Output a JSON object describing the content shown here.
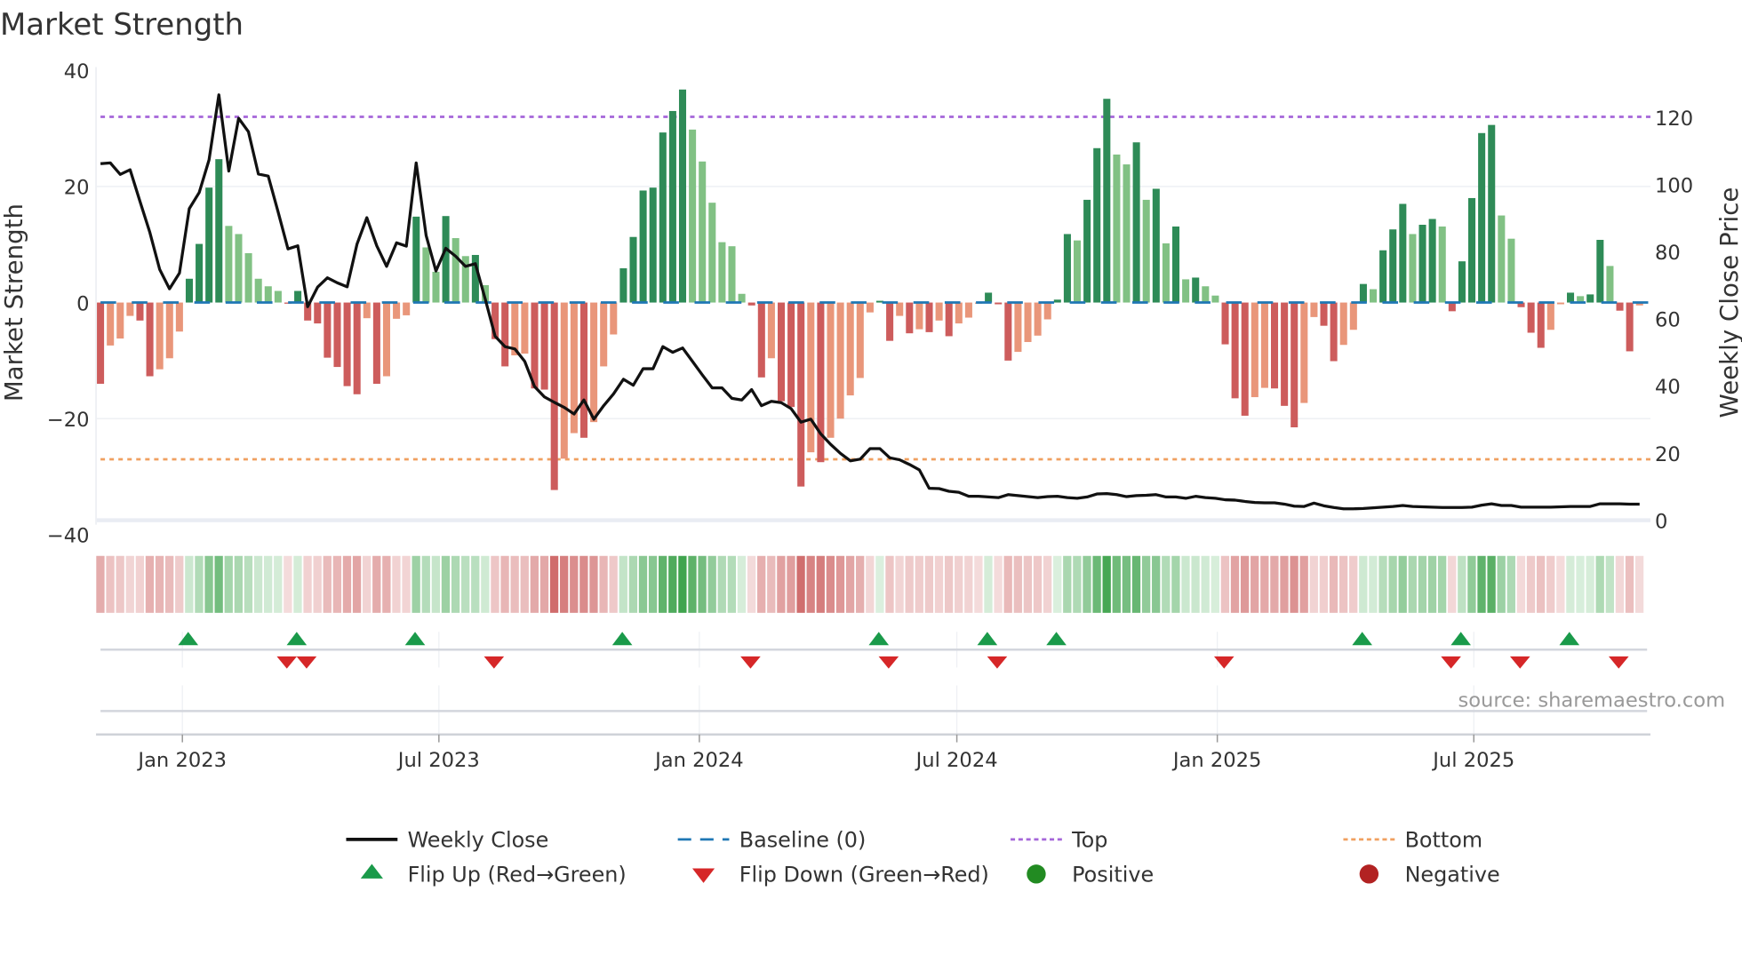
{
  "chart_data": {
    "type": "bar",
    "title": "Market Strength",
    "ylabel": "Market Strength",
    "y2label": "Weekly Close Price",
    "ylim": [
      -40,
      40
    ],
    "y2lim": [
      -4.3,
      134
    ],
    "yticks": [
      "40",
      "20",
      "0",
      "−20",
      "−40"
    ],
    "ytick_values": [
      40,
      20,
      0,
      -20,
      -40
    ],
    "y2ticks": [
      "120",
      "100",
      "80",
      "60",
      "40",
      "20",
      "0"
    ],
    "y2tick_values": [
      120,
      100,
      80,
      60,
      40,
      20,
      0
    ],
    "x_unit": "week index",
    "xticks": [
      {
        "label": "Jan 2023",
        "week": 9.3
      },
      {
        "label": "Jul 2023",
        "week": 35.3
      },
      {
        "label": "Jan 2024",
        "week": 61.7
      },
      {
        "label": "Jul 2024",
        "week": 87.8
      },
      {
        "label": "Jan 2025",
        "week": 114.2
      },
      {
        "label": "Jul 2025",
        "week": 140.2
      }
    ],
    "top_level": 32,
    "bottom_level": -27,
    "baseline": 0,
    "grid": true,
    "legend_placement": "bottom",
    "series": [
      {
        "name": "Market Strength",
        "type": "bar",
        "values": [
          -14,
          -7.4,
          -6.2,
          -2.3,
          -3.1,
          -12.7,
          -11.5,
          -9.6,
          -5,
          4.1,
          10.1,
          19.8,
          24.7,
          13.2,
          11.8,
          8.5,
          4.1,
          2.8,
          2,
          -0.2,
          2,
          -3.1,
          -3.6,
          -9.5,
          -11.1,
          -14.4,
          -15.8,
          -2.7,
          -14,
          -12.7,
          -2.8,
          -2.2,
          14.8,
          9.5,
          5.3,
          14.9,
          11.1,
          8,
          8.2,
          3,
          -6.3,
          -11,
          -9.1,
          -8.8,
          -14.8,
          -15,
          -32.3,
          -26.9,
          -22.5,
          -23.3,
          -20.6,
          -11,
          -5.5,
          5.9,
          11.3,
          19.3,
          19.8,
          29.3,
          33,
          36.7,
          29.8,
          24.3,
          17.2,
          10.4,
          9.7,
          1.5,
          -0.5,
          -12.9,
          -9.6,
          -17,
          -18,
          -31.7,
          -25.8,
          -27.5,
          -23.3,
          -20,
          -16,
          -13,
          -1.7,
          0.3,
          -6.6,
          -2.3,
          -5.3,
          -4.6,
          -5.1,
          -3.1,
          -5.8,
          -3.6,
          -2.6,
          -0.2,
          1.7,
          -0.3,
          -10,
          -8.5,
          -6.8,
          -5.7,
          -2.9,
          0.5,
          11.8,
          10.7,
          17.7,
          26.6,
          35.1,
          25.5,
          23.8,
          27.6,
          17.7,
          19.6,
          10.2,
          13.1,
          4,
          4.3,
          2.8,
          1.2,
          -7.2,
          -16.5,
          -19.5,
          -16.3,
          -14.7,
          -14.8,
          -17.8,
          -21.5,
          -17.3,
          -2.5,
          -4,
          -10.1,
          -7.3,
          -4.7,
          3.2,
          2.3,
          9,
          12.6,
          17,
          11.8,
          13.4,
          14.4,
          13.1,
          -1.5,
          7.1,
          18,
          29.2,
          30.6,
          15,
          11,
          -0.8,
          -5.2,
          -7.8,
          -4.7,
          -0.3,
          1.7,
          1.1,
          1.4,
          10.8,
          6.3,
          -1.4,
          -8.4,
          -0.5
        ]
      },
      {
        "name": "Weekly Close",
        "type": "line",
        "axis": "right",
        "values": [
          106.2,
          106.4,
          103,
          104.4,
          95,
          85.7,
          74.7,
          68.9,
          73.6,
          92.8,
          97.6,
          107.3,
          126.7,
          104,
          119.7,
          115.7,
          103.1,
          102.5,
          91.9,
          80.8,
          81.7,
          63.6,
          69.4,
          72.2,
          70.7,
          69.5,
          82.2,
          90.1,
          81.7,
          75.6,
          82.6,
          81.6,
          106.4,
          84.8,
          74.2,
          81,
          78.6,
          75.6,
          76.4,
          65.8,
          54.8,
          51.7,
          51,
          47.3,
          39.8,
          36.7,
          35.1,
          33.6,
          31.6,
          35.8,
          30.1,
          34.1,
          37.6,
          42,
          40.2,
          45.1,
          45.1,
          51.7,
          50,
          51.3,
          47.3,
          43.3,
          39.4,
          39.4,
          36.3,
          35.8,
          38.9,
          34.1,
          35.4,
          35,
          33.2,
          29.2,
          30.1,
          25.7,
          22.6,
          19.9,
          17.7,
          18.2,
          21.3,
          21.3,
          18.6,
          18,
          16.6,
          15,
          9.5,
          9.4,
          8.6,
          8.3,
          7.1,
          7.1,
          6.9,
          6.7,
          7.6,
          7.3,
          7,
          6.7,
          7,
          7.1,
          6.7,
          6.5,
          6.9,
          7.8,
          7.9,
          7.6,
          7,
          7.3,
          7.4,
          7.6,
          6.9,
          6.9,
          6.5,
          7.1,
          6.7,
          6.5,
          6.1,
          6,
          5.6,
          5.3,
          5.2,
          5.2,
          4.8,
          4.2,
          4.1,
          5.1,
          4.3,
          3.8,
          3.4,
          3.4,
          3.5,
          3.7,
          3.9,
          4.1,
          4.4,
          4.1,
          4,
          3.9,
          3.8,
          3.8,
          3.8,
          3.9,
          4.5,
          4.9,
          4.4,
          4.4,
          3.9,
          3.9,
          3.9,
          3.9,
          4,
          4.1,
          4.1,
          4.1,
          4.9,
          4.9,
          4.9,
          4.8,
          4.8
        ]
      }
    ],
    "legend": [
      {
        "label": "Weekly Close",
        "symbol": "line"
      },
      {
        "label": "Baseline (0)",
        "symbol": "dashed-line"
      },
      {
        "label": "Top",
        "symbol": "dotted-line"
      },
      {
        "label": "Bottom",
        "symbol": "dotted-line"
      },
      {
        "label": "Flip Up (Red→Green)",
        "symbol": "triangle-up"
      },
      {
        "label": "Flip Down (Green→Red)",
        "symbol": "triangle-down"
      },
      {
        "label": "Positive",
        "symbol": "circle"
      },
      {
        "label": "Negative",
        "symbol": "circle"
      }
    ],
    "source": "source: sharemaestro.com"
  },
  "colors": {
    "pos_strong": "#2e8b57",
    "pos_weak": "#81c184",
    "neg_strong": "#cd5c5c",
    "neg_weak": "#e9967a",
    "line": "#111111",
    "baseline": "#1f77b4",
    "top": "#a566d9",
    "bottom": "#f0a060",
    "flip_up": "#1a9a4a",
    "flip_down": "#d62728",
    "positive": "#228b22",
    "negative": "#b22222"
  }
}
